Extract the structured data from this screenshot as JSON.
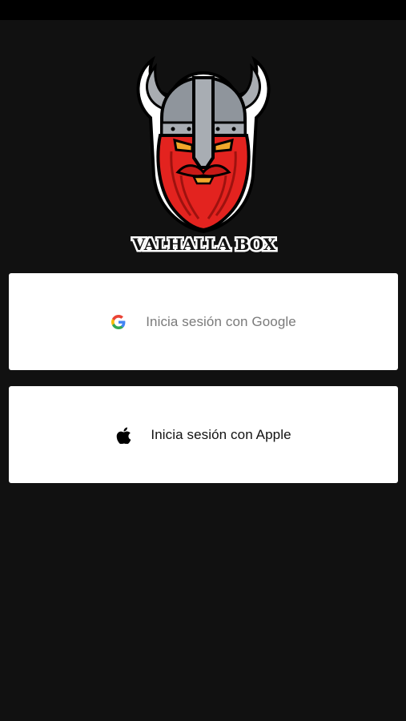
{
  "app": {
    "brand_name": "VALHALLA BOX"
  },
  "login": {
    "google_label": "Inicia sesión con Google",
    "apple_label": "Inicia sesión con Apple"
  },
  "icons": {
    "google": "google-g-icon",
    "apple": "apple-logo-icon"
  },
  "colors": {
    "background": "#111111",
    "status_bar": "#000000",
    "button_bg": "#ffffff",
    "google_text": "#7a7a7a",
    "apple_text": "#111111",
    "beard_red": "#e3231f",
    "helmet_gray": "#8f959c"
  }
}
